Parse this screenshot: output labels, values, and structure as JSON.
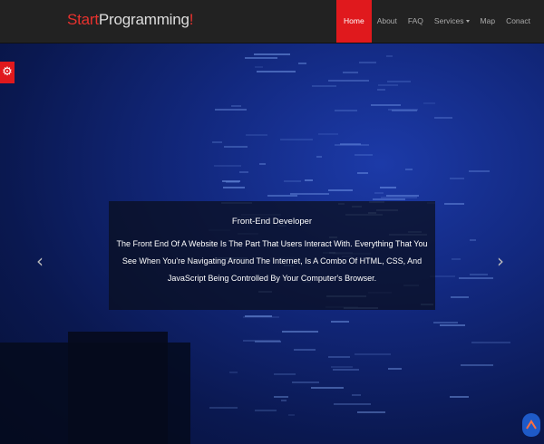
{
  "brand": {
    "part1": "Start",
    "part2": "Programming",
    "part3": "!"
  },
  "nav": {
    "items": [
      {
        "label": "Home"
      },
      {
        "label": "About"
      },
      {
        "label": "FAQ"
      },
      {
        "label": "Services"
      },
      {
        "label": "Map"
      },
      {
        "label": "Conact"
      }
    ]
  },
  "hero": {
    "title": "Front-End Developer",
    "text": "The Front End Of A Website Is The Part That Users Interact With. Everything That You See When You're Navigating Around The Internet, Is A Combo Of HTML, CSS, And JavaScript Being Controlled By Your Computer's Browser.",
    "prev_glyph": "‹",
    "next_glyph": "›"
  },
  "icons": {
    "settings": "gear-icon",
    "scroll_top": "arrow-up-icon"
  },
  "colors": {
    "accent": "#e0191d",
    "navbar": "#222222",
    "hero": "#12287e",
    "scroll_top": "#1e5ac8"
  }
}
